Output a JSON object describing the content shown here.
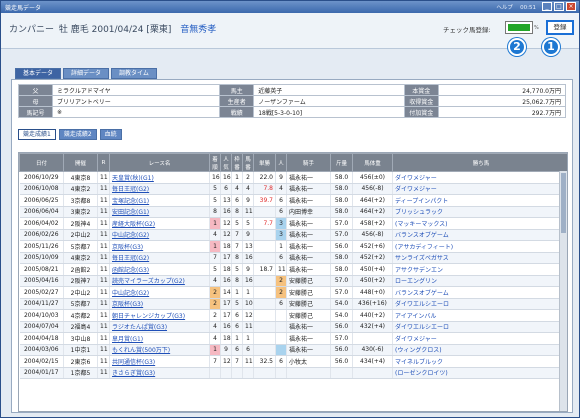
{
  "window": {
    "title": "競走馬データ",
    "right_text": "ヘルプ　 00:51",
    "btn_min": "_",
    "btn_max": "□",
    "btn_close": "×"
  },
  "header": {
    "name": "カンパニー",
    "details": "牡 鹿毛 2001/04/24 [栗東]",
    "trainer": "音無秀孝",
    "check_label": "チェック馬登録:",
    "check_pct": "%",
    "register_label": "登録",
    "marker1": "1",
    "marker2": "2"
  },
  "tabs": [
    "基本データ",
    "詳細データ",
    "調教タイム"
  ],
  "info": [
    [
      "父",
      "ミラクルアドマイヤ",
      "馬主",
      "近藤英子",
      "本賞金",
      "24,770.0万円"
    ],
    [
      "母",
      "ブリリアントベリー",
      "生産者",
      "ノーザンファーム",
      "収得賞金",
      "25,062.7万円"
    ],
    [
      "馬記号",
      "※",
      "戦績",
      "18戦[5-3-0-10]",
      "付加賞金",
      "292.7万円"
    ]
  ],
  "subtabs": [
    "競走成績1",
    "競走成績2",
    "血統"
  ],
  "columns": [
    "日付",
    "開催",
    "R",
    "レース名",
    "着順",
    "人気",
    "枠番",
    "馬番",
    "単勝",
    "人",
    "騎手",
    "斤量",
    "馬体重",
    "勝ち馬"
  ],
  "rows": [
    [
      "2006/10/29",
      "4東京8",
      "11",
      "天皇賞(秋)(G1)",
      "16",
      "16",
      "1",
      "2",
      "22.0",
      "9",
      "福永祐一",
      "58.0",
      "456(±0)",
      "ダイワメジャー",
      "",
      "",
      ""
    ],
    [
      "2006/10/08",
      "4東京2",
      "11",
      "毎日王冠(G2)",
      "5",
      "6",
      "4",
      "4",
      "7.8",
      "4",
      "福永祐一",
      "58.0",
      "456(-8)",
      "ダイワメジャー",
      "",
      "",
      "red"
    ],
    [
      "2006/06/25",
      "3京都8",
      "11",
      "宝塚記念(G1)",
      "5",
      "13",
      "6",
      "9",
      "39.7",
      "6",
      "福永祐一",
      "58.0",
      "464(+2)",
      "ディープインパクト",
      "",
      "",
      "red"
    ],
    [
      "2006/06/04",
      "3東京2",
      "11",
      "安田記念(G1)",
      "8",
      "16",
      "8",
      "11",
      "",
      "6",
      "内田博幸",
      "58.0",
      "464(+2)",
      "ブリッシュラック",
      "",
      "",
      ""
    ],
    [
      "2006/04/02",
      "2阪神4",
      "11",
      "産経大阪杯(G2)",
      "1",
      "12",
      "5",
      "5",
      "7.7",
      "3",
      "福永祐一",
      "57.0",
      "458(+2)",
      "(マッキーマックス)",
      "pink",
      "blue",
      "red"
    ],
    [
      "2006/02/26",
      "2中山2",
      "11",
      "中山記念(G2)",
      "4",
      "12",
      "7",
      "9",
      "",
      "3",
      "福永祐一",
      "57.0",
      "456(-8)",
      "バランスオブゲーム",
      "",
      "blue",
      ""
    ],
    [
      "2005/11/26",
      "5京都7",
      "11",
      "京阪杯(G3)",
      "1",
      "18",
      "7",
      "13",
      "",
      "1",
      "福永祐一",
      "56.0",
      "452(+6)",
      "(アサカディフィート)",
      "pink",
      "",
      ""
    ],
    [
      "2005/10/09",
      "4東京2",
      "11",
      "毎日王冠(G2)",
      "7",
      "17",
      "8",
      "16",
      "",
      "6",
      "福永祐一",
      "58.0",
      "452(+2)",
      "サンライズペガサス",
      "",
      "",
      ""
    ],
    [
      "2005/08/21",
      "2函館2",
      "11",
      "函館記念(G3)",
      "5",
      "18",
      "5",
      "9",
      "18.7",
      "11",
      "福永祐一",
      "58.0",
      "450(+4)",
      "アサクサデンエン",
      "",
      "",
      ""
    ],
    [
      "2005/04/16",
      "2阪神7",
      "11",
      "読売マイラーズカップ(G2)",
      "4",
      "16",
      "8",
      "16",
      "",
      "2",
      "安藤勝己",
      "57.0",
      "450(+2)",
      "ローエングリン",
      "",
      "orange",
      ""
    ],
    [
      "2005/02/27",
      "2中山2",
      "11",
      "中山記念(G2)",
      "2",
      "14",
      "1",
      "1",
      "",
      "2",
      "安藤勝己",
      "57.0",
      "448(+0)",
      "バランスオブゲーム",
      "orange",
      "orange",
      ""
    ],
    [
      "2004/11/27",
      "5京都7",
      "11",
      "京阪杯(G3)",
      "2",
      "17",
      "5",
      "10",
      "",
      "6",
      "安藤勝己",
      "54.0",
      "436(+16)",
      "ダイワエルシエーロ",
      "orange",
      "",
      ""
    ],
    [
      "2004/10/03",
      "4京都2",
      "11",
      "朝日チャレンジカップ(G3)",
      "2",
      "17",
      "6",
      "12",
      "",
      "",
      "安藤勝己",
      "54.0",
      "440(+2)",
      "アイアインバル",
      "",
      "",
      ""
    ],
    [
      "2004/07/04",
      "2福島4",
      "11",
      "ラジオたんぱ賞(G3)",
      "4",
      "16",
      "6",
      "11",
      "",
      "",
      "福永祐一",
      "56.0",
      "432(+4)",
      "ダイワエルシエーロ",
      "",
      "",
      ""
    ],
    [
      "2004/04/18",
      "3中山8",
      "11",
      "皐月賞(G1)",
      "4",
      "18",
      "1",
      "1",
      "",
      "",
      "福永祐一",
      "57.0",
      "",
      "ダイワメジャー",
      "",
      "",
      ""
    ],
    [
      "2004/03/06",
      "1中京1",
      "11",
      "もくれん賞(500万下)",
      "1",
      "9",
      "6",
      "6",
      "",
      "",
      "福永祐一",
      "56.0",
      "430(-6)",
      "(ウィングクロス)",
      "pink",
      "blue",
      ""
    ],
    [
      "2004/02/15",
      "2東京6",
      "11",
      "共同通信杯(G3)",
      "7",
      "12",
      "7",
      "11",
      "32.5",
      "6",
      "小牧太",
      "56.0",
      "434(+4)",
      "マイネルブルック",
      "",
      "",
      ""
    ],
    [
      "2004/01/17",
      "1京都5",
      "11",
      "きさらぎ賞(G3)",
      "",
      "",
      "",
      "",
      "",
      "",
      "",
      "",
      "",
      "(ローゼンクロイツ)",
      "",
      "",
      ""
    ]
  ]
}
